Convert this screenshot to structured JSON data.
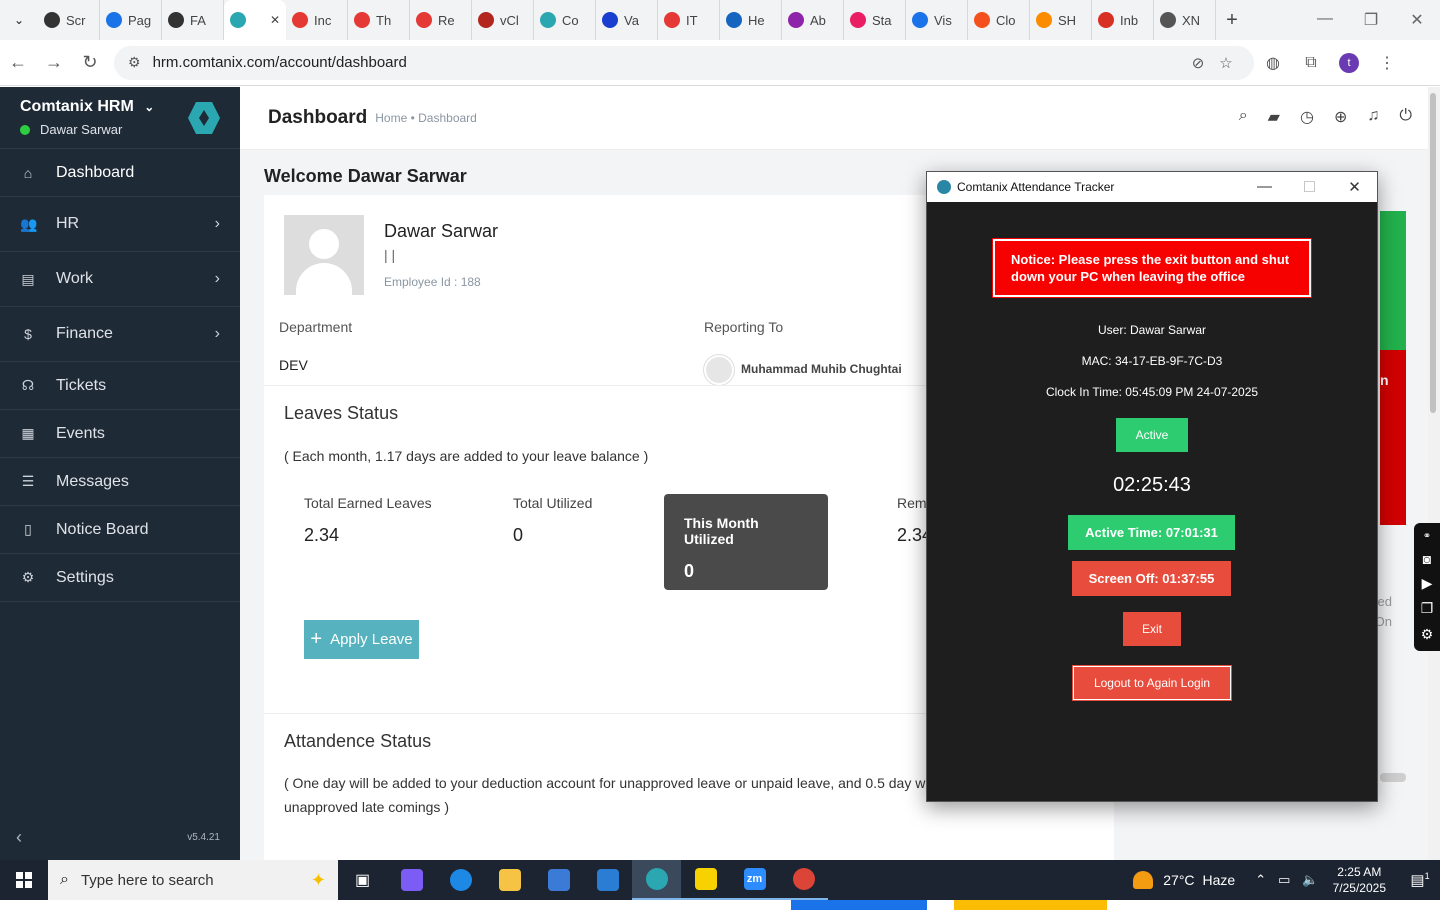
{
  "browser": {
    "tabs": [
      {
        "label": "Scr",
        "color": "#333333"
      },
      {
        "label": "Pag",
        "color": "#1a73e8"
      },
      {
        "label": "FA",
        "color": "#333333"
      },
      {
        "label": "",
        "color": "#2aa7b0",
        "active": true
      },
      {
        "label": "Inc",
        "color": "#e53935"
      },
      {
        "label": "Th",
        "color": "#e53935"
      },
      {
        "label": "Re",
        "color": "#e53935"
      },
      {
        "label": "vCl",
        "color": "#b3261e"
      },
      {
        "label": "Co",
        "color": "#2aa7b0"
      },
      {
        "label": "Va",
        "color": "#1a3fd0"
      },
      {
        "label": "IT",
        "color": "#e53935"
      },
      {
        "label": "He",
        "color": "#1565c0"
      },
      {
        "label": "Ab",
        "color": "#8e24aa"
      },
      {
        "label": "Sta",
        "color": "#e91e63"
      },
      {
        "label": "Vis",
        "color": "#1a73e8"
      },
      {
        "label": "Clo",
        "color": "#f4511e"
      },
      {
        "label": "SH",
        "color": "#fb8c00"
      },
      {
        "label": "Inb",
        "color": "#d93025"
      },
      {
        "label": "XN",
        "color": "#555555"
      }
    ],
    "url": "hrm.comtanix.com/account/dashboard",
    "profile_initial": "t"
  },
  "sidebar": {
    "app_name": "Comtanix HRM",
    "user": "Dawar Sarwar",
    "items": [
      {
        "label": "Dashboard",
        "icon": "home-icon",
        "glyph": "⌂"
      },
      {
        "label": "HR",
        "icon": "users-icon",
        "glyph": "👥"
      },
      {
        "label": "Work",
        "icon": "briefcase-icon",
        "glyph": "▤"
      },
      {
        "label": "Finance",
        "icon": "dollar-icon",
        "glyph": "$"
      },
      {
        "label": "Tickets",
        "icon": "headset-icon",
        "glyph": "☊"
      },
      {
        "label": "Events",
        "icon": "calendar-icon",
        "glyph": "▦"
      },
      {
        "label": "Messages",
        "icon": "message-icon",
        "glyph": "☰"
      },
      {
        "label": "Notice Board",
        "icon": "clipboard-icon",
        "glyph": "▯"
      },
      {
        "label": "Settings",
        "icon": "gear-icon",
        "glyph": "⚙"
      }
    ],
    "version": "v5.4.21"
  },
  "header": {
    "title": "Dashboard",
    "breadcrumb": "Home • Dashboard"
  },
  "main": {
    "welcome": "Welcome Dawar Sarwar",
    "profile": {
      "name": "Dawar Sarwar",
      "bars": "| |",
      "employee_id": "Employee Id : 188",
      "department_label": "Department",
      "department": "DEV",
      "reporting_label": "Reporting To",
      "reporting_to": "Muhammad Muhib Chughtai"
    },
    "leaves": {
      "title": "Leaves Status",
      "note": "( Each month, 1.17 days are added to your leave balance )",
      "earned_label": "Total Earned Leaves",
      "earned": "2.34",
      "utilized_label": "Total Utilized",
      "utilized": "0",
      "month_label": "This Month Utilized",
      "month": "0",
      "remaining_label": "Rem",
      "remaining": "2.34",
      "apply_label": "Apply Leave"
    },
    "attendance": {
      "title": "Attandence Status",
      "note_line1": "( One day will be added to your deduction account for unapproved leave or unpaid leave, and 0.5 day w",
      "note_line2": "unapproved late comings )"
    },
    "behind": {
      "red_text": "n",
      "text1": "ted",
      "text2": "On"
    }
  },
  "tracker": {
    "title": "Comtanix Attendance Tracker",
    "notice": "Notice: Please press the exit button and shut down your PC when leaving the office",
    "user": "User: Dawar Sarwar",
    "mac": "MAC: 34-17-EB-9F-7C-D3",
    "clock_in": "Clock In Time: 05:45:09 PM 24-07-2025",
    "status": "Active",
    "timer": "02:25:43",
    "active_time": "Active Time: 07:01:31",
    "screen_off": "Screen Off: 01:37:55",
    "exit": "Exit",
    "logout": "Logout to Again Login"
  },
  "taskbar": {
    "search_placeholder": "Type here to search",
    "temperature": "27°C",
    "weather": "Haze",
    "time": "2:25 AM",
    "date": "7/25/2025",
    "notification_count": "1"
  }
}
